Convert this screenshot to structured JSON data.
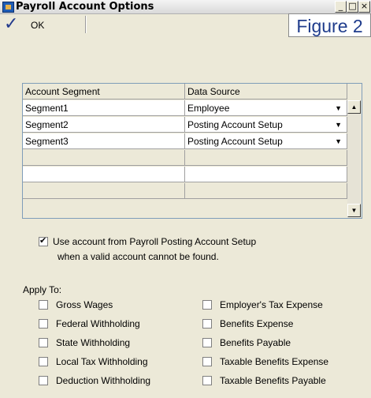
{
  "window": {
    "title": "Payroll Account Options",
    "buttons": {
      "minimize": "_",
      "maximize": "□",
      "close": "×"
    }
  },
  "toolbar": {
    "ok_label": "OK",
    "figure_label": "Figure 2"
  },
  "grid": {
    "columns": [
      "Account Segment",
      "Data Source"
    ],
    "rows": [
      {
        "segment": "Segment1",
        "source": "Employee"
      },
      {
        "segment": "Segment2",
        "source": "Posting Account Setup"
      },
      {
        "segment": "Segment3",
        "source": "Posting Account Setup"
      }
    ],
    "empty_rows": 3
  },
  "use_account": {
    "checked": true,
    "line1": "Use account from Payroll Posting Account Setup",
    "line2": "when a valid account cannot be found."
  },
  "apply_to": {
    "heading": "Apply To:",
    "left": [
      {
        "label": "Gross Wages",
        "checked": false
      },
      {
        "label": "Federal Withholding",
        "checked": false
      },
      {
        "label": "State Withholding",
        "checked": false
      },
      {
        "label": "Local Tax Withholding",
        "checked": false
      },
      {
        "label": "Deduction Withholding",
        "checked": false
      }
    ],
    "right": [
      {
        "label": "Employer's Tax Expense",
        "checked": false
      },
      {
        "label": "Benefits Expense",
        "checked": false
      },
      {
        "label": "Benefits Payable",
        "checked": false
      },
      {
        "label": "Taxable Benefits Expense",
        "checked": false
      },
      {
        "label": "Taxable Benefits Payable",
        "checked": false
      }
    ]
  },
  "icons": {
    "title": "payroll-window-icon",
    "ok": "checkmark-icon",
    "dropdown": "dropdown-arrow-icon"
  }
}
